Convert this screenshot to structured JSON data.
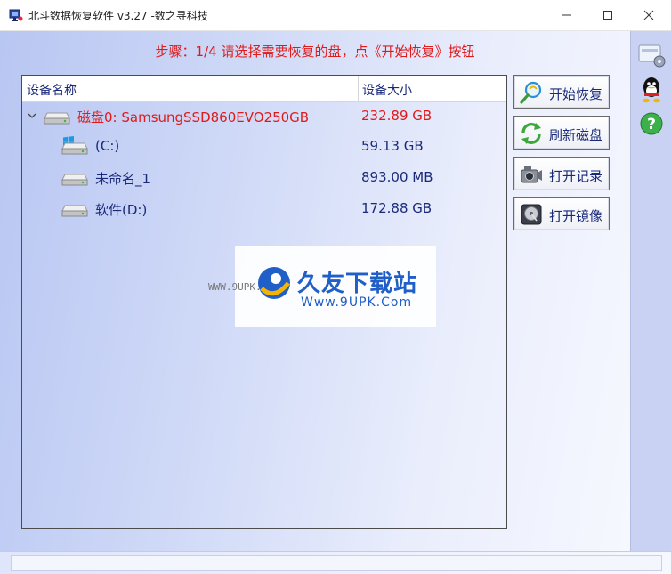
{
  "window": {
    "title": "北斗数据恢复软件 v3.27 -数之寻科技"
  },
  "step_text": "步骤：1/4 请选择需要恢复的盘，点《开始恢复》按钮",
  "table": {
    "columns": [
      "设备名称",
      "设备大小"
    ],
    "rows": [
      {
        "label": "磁盘0: SamsungSSD860EVO250GB",
        "size": "232.89 GB",
        "type": "disk"
      },
      {
        "label": "(C:)",
        "size": "59.13 GB",
        "type": "partition",
        "icon": "windows-logo-icon"
      },
      {
        "label": "未命名_1",
        "size": "893.00 MB",
        "type": "partition"
      },
      {
        "label": "软件(D:)",
        "size": "172.88 GB",
        "type": "partition"
      }
    ]
  },
  "actions": [
    {
      "label": "开始恢复",
      "icon": "magnifier-recover-icon"
    },
    {
      "label": "刷新磁盘",
      "icon": "refresh-icon"
    },
    {
      "label": "打开记录",
      "icon": "camera-icon"
    },
    {
      "label": "打开镜像",
      "icon": "hard-disk-icon"
    }
  ],
  "sidebar": [
    "settings-icon",
    "qq-icon",
    "help-icon"
  ],
  "watermark": {
    "cn": "久友下载站",
    "en": "Www.9UPK.Com",
    "small": "WWW.9UPK.COM"
  },
  "colors": {
    "accent_red": "#e01a1a",
    "text_blue": "#1a2a7a",
    "watermark_blue": "#1f5fc7"
  }
}
